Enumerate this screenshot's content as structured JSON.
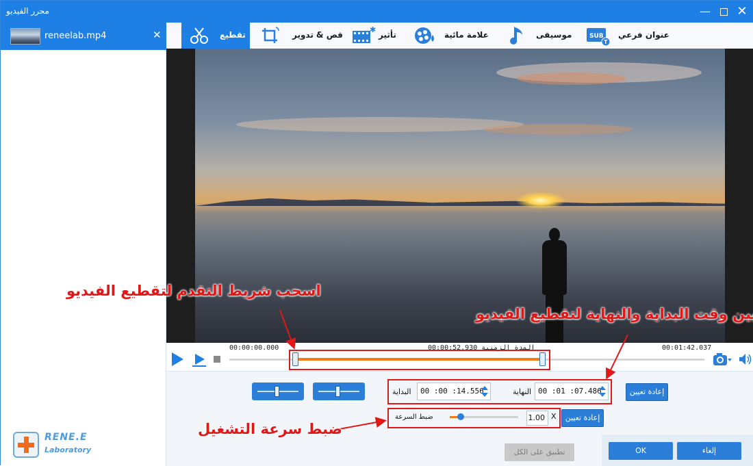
{
  "window": {
    "title": "محرر الفيديو"
  },
  "file": {
    "name": "reneelab.mp4"
  },
  "toolbar": {
    "tools": [
      {
        "label": "تقطيع",
        "icon": "scissors-icon",
        "active": true
      },
      {
        "label": "قص & تدوير",
        "icon": "crop-rotate-icon",
        "active": false
      },
      {
        "label": "تأثير",
        "icon": "effect-film-icon",
        "active": false
      },
      {
        "label": "علامة مائية",
        "icon": "watermark-icon",
        "active": false
      },
      {
        "label": "موسيقى",
        "icon": "music-note-icon",
        "active": false
      },
      {
        "label": "عنوان فرعي",
        "icon": "subtitle-icon",
        "active": false
      }
    ]
  },
  "timeline": {
    "start_time": "00:00:00.000",
    "duration_label": "00:00:52.930 المدة الزمنية",
    "end_time": "00:01:42.037",
    "selection_start_fraction": 0.138,
    "selection_end_fraction": 0.66
  },
  "trim": {
    "start_label": "البداية",
    "start_value": "00 :00 :14.556",
    "end_label": "النهاية",
    "end_value": "00 :01 :07.486",
    "reset_label": "إعادة تعيين"
  },
  "speed": {
    "label": "ضبط السرعة",
    "value": "1.00",
    "unit": "X",
    "reset_label": "إعادة تعيين",
    "level_fraction": 0.16
  },
  "footer": {
    "apply_all": "تطبيق على الكل",
    "ok": "OK",
    "cancel": "إلغاء"
  },
  "logo": {
    "brand": "RENE.E",
    "sub": "Laboratory"
  },
  "annotations": {
    "drag_progress": "اسحب شريط التقدم لتقطيع الفيديو",
    "set_times": "تعيين وقت البداية والنهاية لتقطيع الفيديو",
    "adjust_speed": "ضبط سرعة التشغيل"
  },
  "colors": {
    "accent": "#1e80e5",
    "highlight": "#f57b18",
    "annotation": "#e01818"
  }
}
